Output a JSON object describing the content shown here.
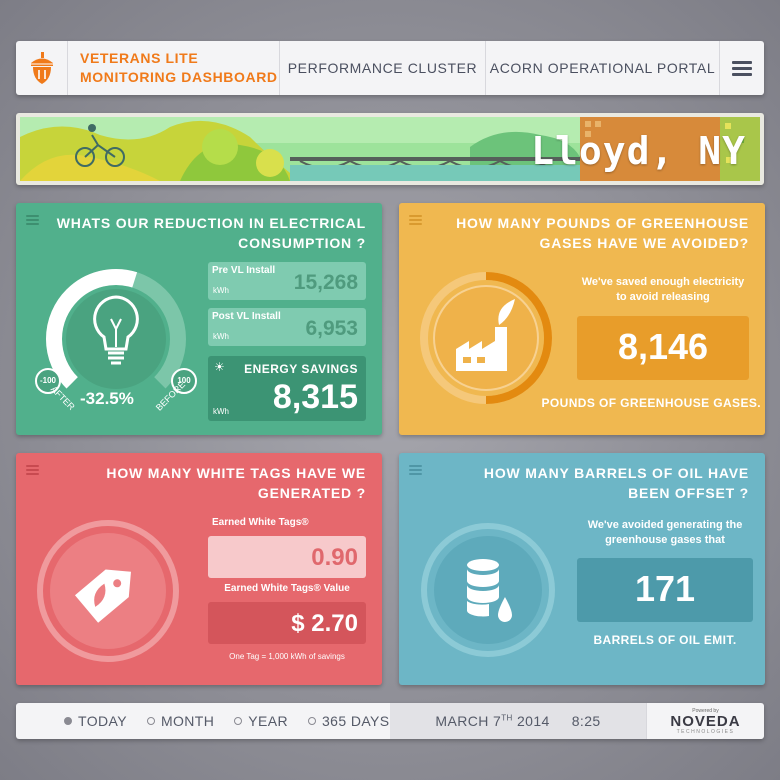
{
  "header": {
    "title_line1": "VETERANS LITE",
    "title_line2": "MONITORING DASHBOARD",
    "nav": [
      "PERFORMANCE CLUSTER",
      "ACORN OPERATIONAL PORTAL"
    ],
    "accent": "#f07a1a"
  },
  "banner": {
    "city": "Lloyd, NY"
  },
  "electrical": {
    "title_line1": "WHATS OUR REDUCTION IN ELECTRICAL",
    "title_line2": "CONSUMPTION ?",
    "gauge_min": "-100",
    "gauge_max": "100",
    "gauge_left_label": "AFTER",
    "gauge_right_label": "BEFORE",
    "gauge_value": "-32.5%",
    "pre_label": "Pre VL Install",
    "pre_value": "15,268",
    "pre_unit": "kWh",
    "post_label": "Post VL Install",
    "post_value": "6,953",
    "post_unit": "kWh",
    "savings_label": "ENERGY SAVINGS",
    "savings_value": "8,315",
    "savings_unit": "kWh",
    "color": "#51b08c"
  },
  "greenhouse": {
    "title_line1": "HOW MANY POUNDS OF GREENHOUSE",
    "title_line2": "GASES HAVE WE AVOIDED?",
    "desc_line1": "We've saved enough electricity",
    "desc_line2": "to avoid releasing",
    "value": "8,146",
    "caption": "POUNDS OF GREENHOUSE GASES.",
    "color": "#f0b850"
  },
  "white_tags": {
    "title_line1": "HOW MANY WHITE TAGS HAVE WE",
    "title_line2": "GENERATED ?",
    "earned_label": "Earned White Tags®",
    "earned_value": "0.90",
    "value_label": "Earned White Tags® Value",
    "value_amount": "$ 2.70",
    "note": "One Tag = 1,000 kWh of savings",
    "color": "#e6686d"
  },
  "oil": {
    "title_line1": "HOW MANY BARRELS OF OIL HAVE",
    "title_line2": "BEEN OFFSET ?",
    "desc_line1": "We've avoided generating the",
    "desc_line2": "greenhouse gases that",
    "value": "171",
    "caption": "BARRELS OF OIL EMIT.",
    "color": "#6db6c6"
  },
  "footer": {
    "ranges": [
      "TODAY",
      "MONTH",
      "YEAR",
      "365 DAYS"
    ],
    "active_range": "TODAY",
    "date_prefix": "MARCH 7",
    "date_sup": "TH",
    "date_year": "2014",
    "time": "8:25",
    "powered_by": "Powered by",
    "brand": "NOVEDA",
    "brand_sub": "TECHNOLOGIES"
  }
}
